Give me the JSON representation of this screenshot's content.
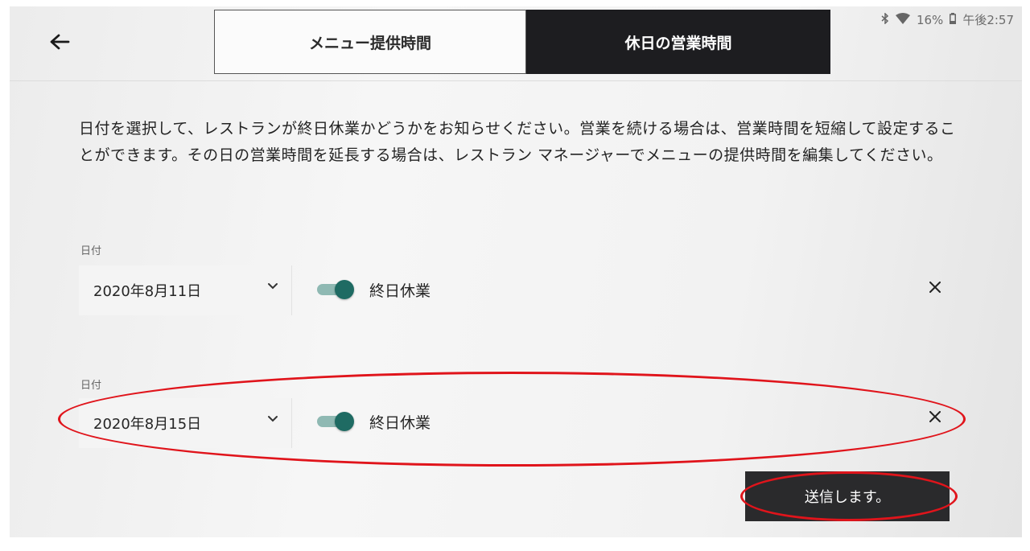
{
  "status_bar": {
    "bluetooth_icon": "bluetooth-icon",
    "wifi_icon": "wifi-icon",
    "battery_percent": "16%",
    "battery_icon": "battery-icon",
    "time": "午後2:57"
  },
  "header": {
    "back_icon": "arrow-left-icon",
    "tabs": [
      {
        "label": "メニュー提供時間",
        "active": false
      },
      {
        "label": "休日の営業時間",
        "active": true
      }
    ]
  },
  "description": "日付を選択して、レストランが終日休業かどうかをお知らせください。営業を続ける場合は、営業時間を短縮して設定することができます。その日の営業時間を延長する場合は、レストラン マネージャーでメニューの提供時間を編集してください。",
  "entries": [
    {
      "label": "日付",
      "date": "2020年8月11日",
      "closed_all_day": true,
      "toggle_label": "終日休業"
    },
    {
      "label": "日付",
      "date": "2020年8月15日",
      "closed_all_day": true,
      "toggle_label": "終日休業"
    }
  ],
  "submit_label": "送信します。",
  "colors": {
    "toggle_on": "#1f6b63",
    "toggle_track": "#8fb9b3",
    "annotation": "#e0141b",
    "dark_button": "#2a2a2c"
  }
}
